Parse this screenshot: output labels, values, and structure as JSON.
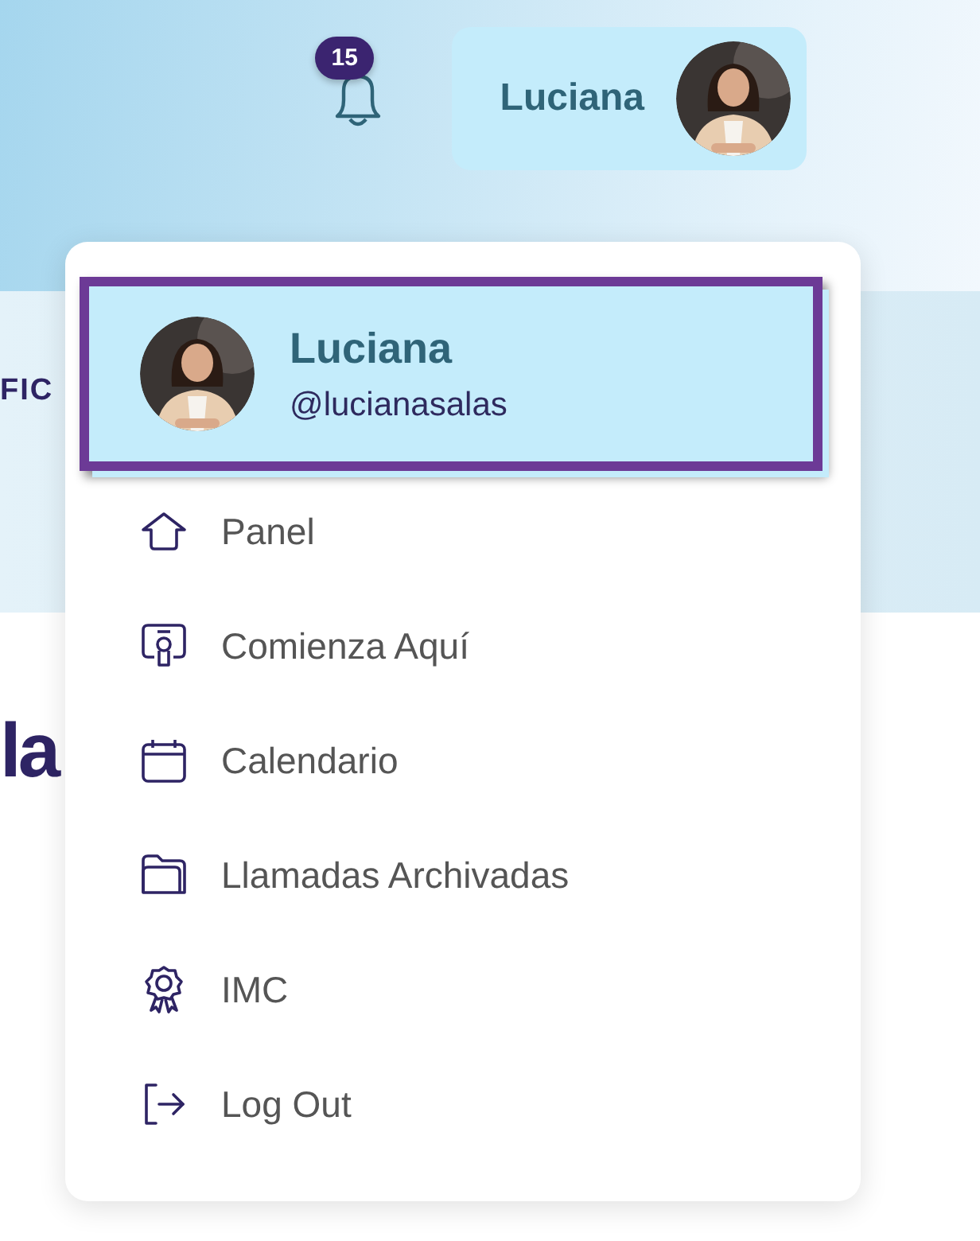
{
  "header": {
    "notifications": {
      "badge": "15"
    },
    "profile_button": {
      "name": "Luciana"
    }
  },
  "background": {
    "section_label": "FIC",
    "heading": "la"
  },
  "menu": {
    "profile": {
      "name": "Luciana",
      "handle": "@lucianasalas",
      "selected": true
    },
    "items": [
      {
        "label": "Panel",
        "selected": false
      },
      {
        "label": "Comienza Aquí",
        "selected": false
      },
      {
        "label": "Calendario",
        "selected": false
      },
      {
        "label": "Llamadas Archivadas",
        "selected": false
      },
      {
        "label": "IMC",
        "selected": false
      },
      {
        "label": "Log Out",
        "selected": false
      }
    ]
  }
}
